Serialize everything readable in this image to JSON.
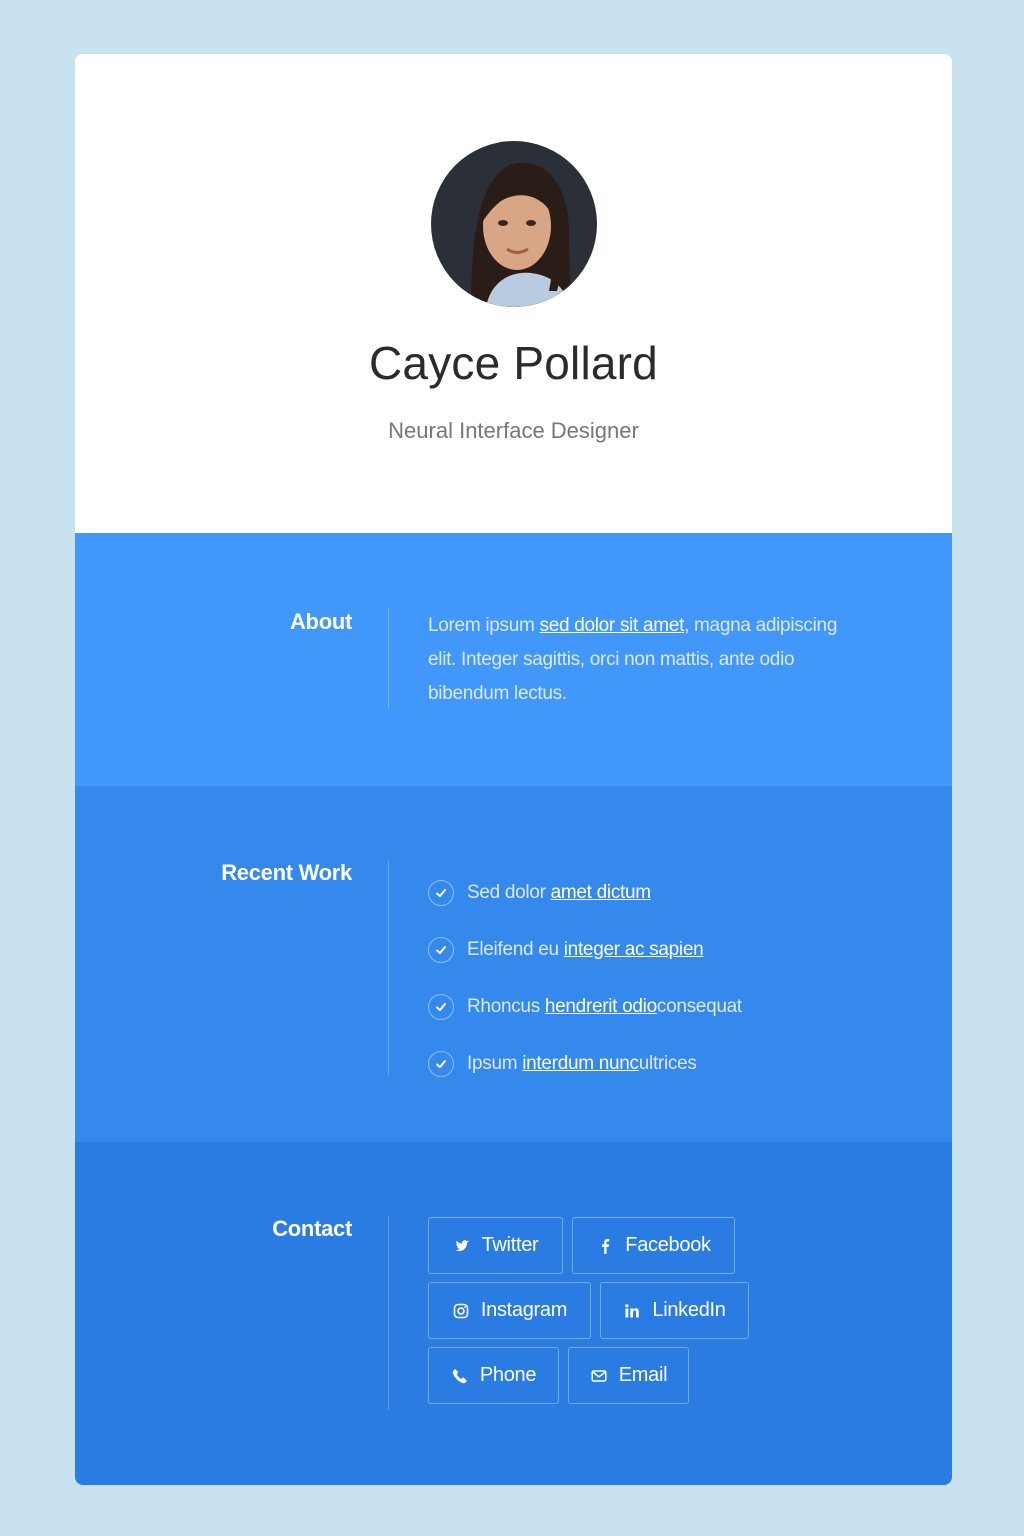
{
  "profile": {
    "name": "Cayce Pollard",
    "title": "Neural Interface Designer"
  },
  "about": {
    "label": "About",
    "text_before": "Lorem ipsum ",
    "link": "sed dolor sit amet",
    "text_after": ", magna adipiscing elit. Integer sagittis, orci non mattis, ante odio bibendum lectus."
  },
  "work": {
    "label": "Recent Work",
    "items": [
      {
        "before": "Sed dolor ",
        "link": "amet dictum",
        "after": ""
      },
      {
        "before": "Eleifend eu ",
        "link": "integer ac sapien",
        "after": ""
      },
      {
        "before": "Rhoncus ",
        "link": "hendrerit odio",
        "after": " consequat"
      },
      {
        "before": "Ipsum ",
        "link": "interdum nunc",
        "after": " ultrices"
      }
    ]
  },
  "contact": {
    "label": "Contact",
    "buttons": [
      {
        "label": "Twitter",
        "icon": "twitter-icon"
      },
      {
        "label": "Facebook",
        "icon": "facebook-icon"
      },
      {
        "label": "Instagram",
        "icon": "instagram-icon"
      },
      {
        "label": "LinkedIn",
        "icon": "linkedin-icon"
      },
      {
        "label": "Phone",
        "icon": "phone-icon"
      },
      {
        "label": "Email",
        "icon": "email-icon"
      }
    ]
  },
  "colors": {
    "page_bg": "#c8e2f0",
    "about_bg": "#4298fa",
    "work_bg": "#3589ec",
    "contact_bg": "#2a7ce3"
  }
}
